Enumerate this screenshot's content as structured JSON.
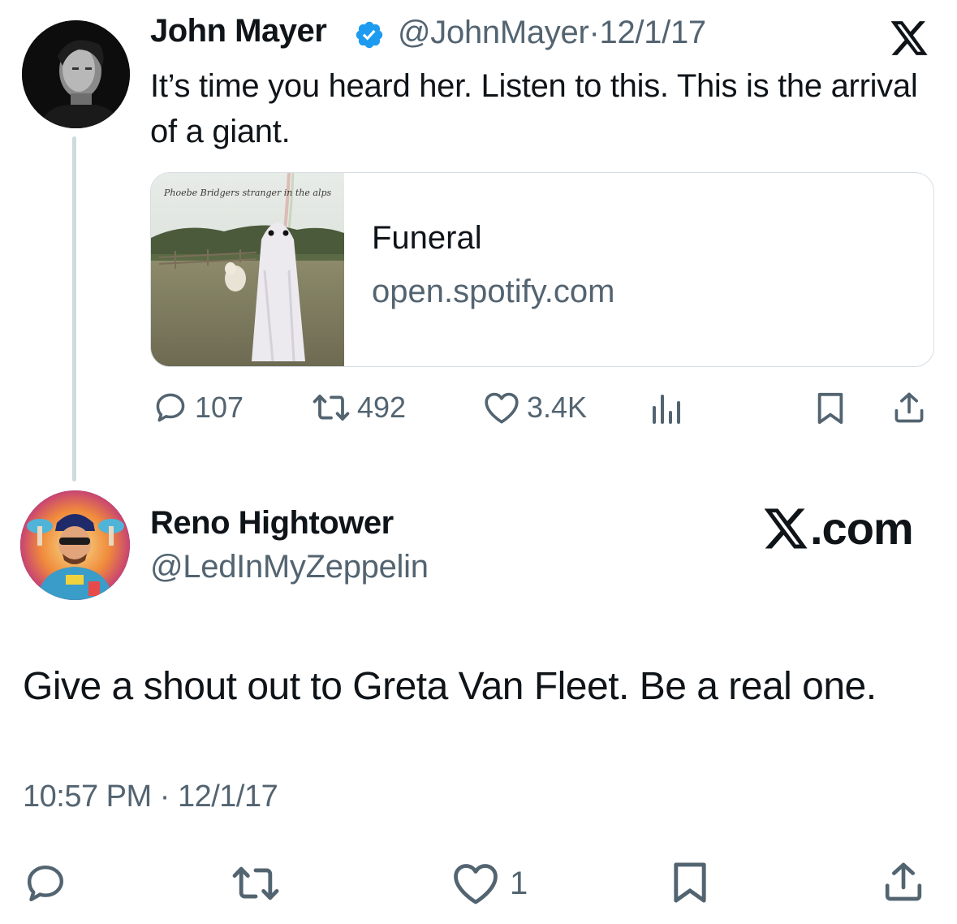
{
  "original_tweet": {
    "author_name": "John Mayer",
    "handle": "@JohnMayer",
    "separator": "·",
    "date": "12/1/17",
    "text": "It’s time you heard her. Listen to this. This is the arrival of a giant.",
    "card": {
      "title": "Funeral",
      "domain": "open.spotify.com",
      "thumbnail_script_text": "Phoebe Bridgers stranger in the alps"
    },
    "stats": {
      "replies": "107",
      "retweets": "492",
      "likes": "3.4K"
    }
  },
  "reply_tweet": {
    "author_name": "Reno Hightower",
    "handle": "@LedInMyZeppelin",
    "brand_text": ".com",
    "text": "Give a shout out to Greta Van Fleet. Be a real one.",
    "time": "10:57 PM",
    "separator": "·",
    "date": "12/1/17",
    "stats": {
      "likes": "1"
    }
  },
  "icons": [
    "x-logo-icon",
    "verified-badge-icon",
    "reply-icon",
    "retweet-icon",
    "like-icon",
    "views-icon",
    "bookmark-icon",
    "share-icon"
  ],
  "colors": {
    "text": "#0f1419",
    "secondary": "#536471",
    "verified": "#1d9bf0",
    "border": "#cfd9de"
  }
}
